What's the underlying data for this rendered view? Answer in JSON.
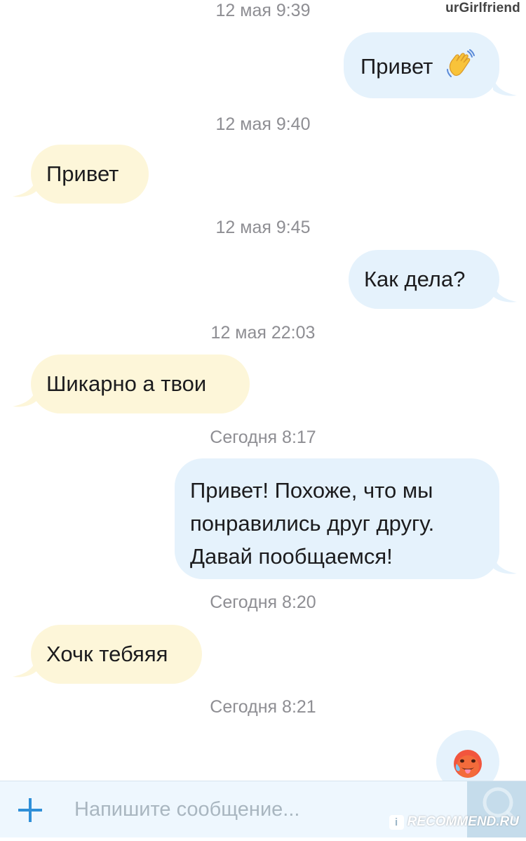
{
  "watermark": "urGirlfriend",
  "messages": [
    {
      "time": "12 мая 9:39",
      "direction": "outgoing",
      "lines": [
        "Привет"
      ],
      "emoji": "waving-hand"
    },
    {
      "time": "12 мая 9:40",
      "direction": "incoming",
      "lines": [
        "Привет"
      ]
    },
    {
      "time": "12 мая 9:45",
      "direction": "outgoing",
      "lines": [
        "Как дела?"
      ]
    },
    {
      "time": "12 мая 22:03",
      "direction": "incoming",
      "lines": [
        "Шикарно а твои"
      ]
    },
    {
      "time": "Сегодня 8:17",
      "direction": "outgoing",
      "lines": [
        "Привет! Похоже, что мы",
        "понравились друг другу.",
        "Давай пообщаемся!"
      ]
    },
    {
      "time": "Сегодня 8:20",
      "direction": "incoming",
      "lines": [
        "Хочк тебяяя"
      ]
    },
    {
      "time": "Сегодня 8:21",
      "direction": "outgoing",
      "lines": [],
      "emoji": "hot-face"
    }
  ],
  "composer": {
    "placeholder": "Напишите сообщение...",
    "plus_icon": "plus-icon",
    "send_icon": "send-icon"
  },
  "site_badge": "RECOMMEND.RU",
  "colors": {
    "incoming_bubble": "#fdf6d9",
    "outgoing_bubble": "#e5f2fc",
    "timestamp": "#8e8e93",
    "accent": "#2f8fd8"
  }
}
